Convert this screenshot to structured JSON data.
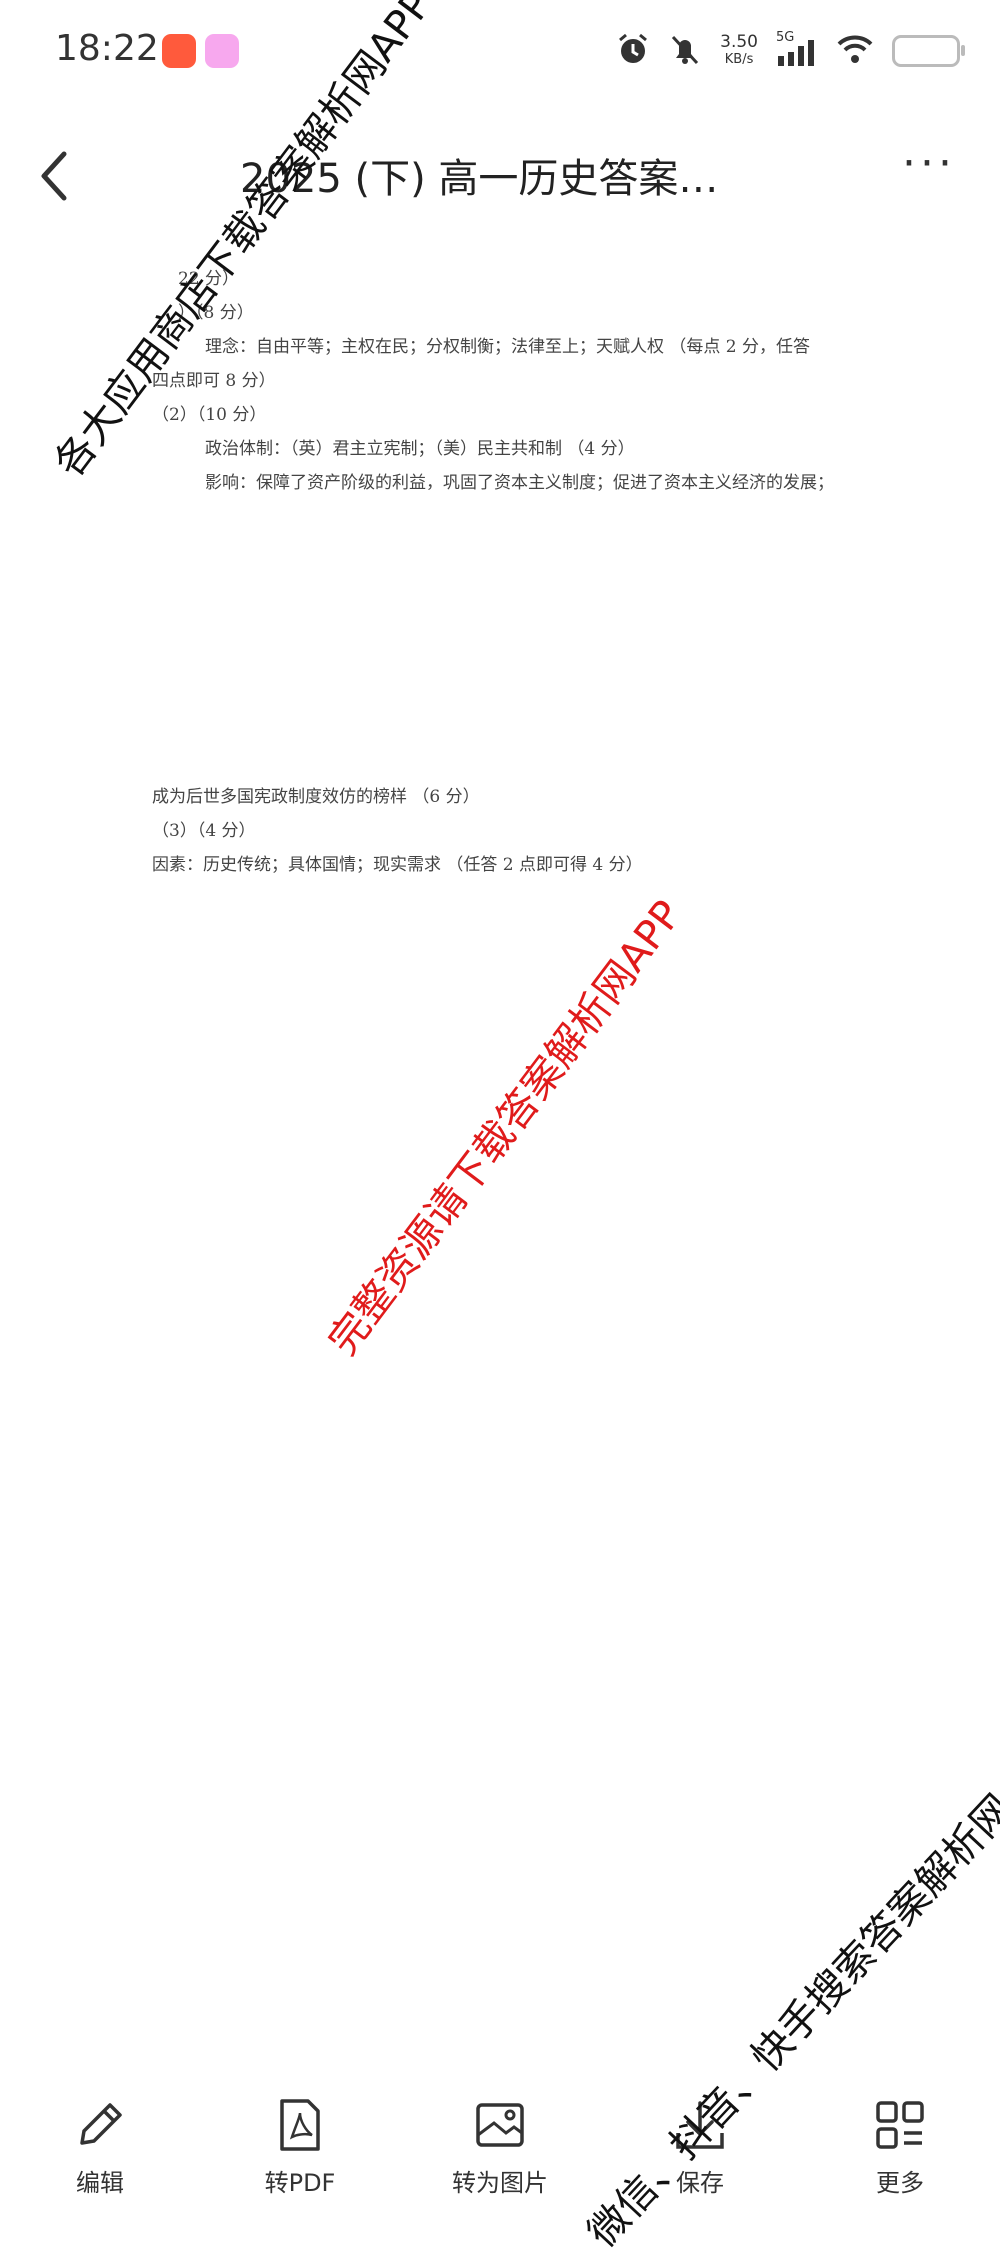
{
  "status_bar": {
    "time": "18:22",
    "net_speed_value": "3.50",
    "net_speed_unit": "KB/s",
    "network": "5G",
    "icons": [
      "alarm-icon",
      "mute-bell-icon",
      "signal-icon",
      "wifi-icon",
      "battery-icon"
    ]
  },
  "header": {
    "title": "2025 (下) 高一历史答案…",
    "back_icon": "chevron-left-icon",
    "more_icon": "more-horizontal-icon"
  },
  "document": {
    "lines": [
      "22 分）",
      "）（8 分）",
      "理念：自由平等；主权在民；分权制衡；法律至上；天赋人权 （每点 2 分，任答",
      "四点即可 8 分）",
      "（2）（10 分）",
      "政治体制：（英）君主立宪制；（美）民主共和制 （4 分）",
      "影响：保障了资产阶级的利益，巩固了资本主义制度；促进了资本主义经济的发展；",
      "成为后世多国宪政制度效仿的榜样 （6 分）",
      "（3）（4 分）",
      "因素：历史传统；具体国情；现实需求 （任答 2 点即可得 4 分）"
    ]
  },
  "watermarks": {
    "top": "各大应用商店下载答案解析网APP",
    "middle": "完整资源请下载答案解析网APP",
    "bottom": "微信、抖音、快手搜索答案解析网"
  },
  "toolbar": {
    "items": [
      {
        "label": "编辑",
        "icon": "pencil-icon"
      },
      {
        "label": "转PDF",
        "icon": "pdf-file-icon"
      },
      {
        "label": "转为图片",
        "icon": "image-icon"
      },
      {
        "label": "保存",
        "icon": "download-icon"
      },
      {
        "label": "更多",
        "icon": "grid-icon"
      }
    ]
  },
  "colors": {
    "background": "#ffffff",
    "watermark_red": "#e01b1b",
    "text": "#222222"
  }
}
